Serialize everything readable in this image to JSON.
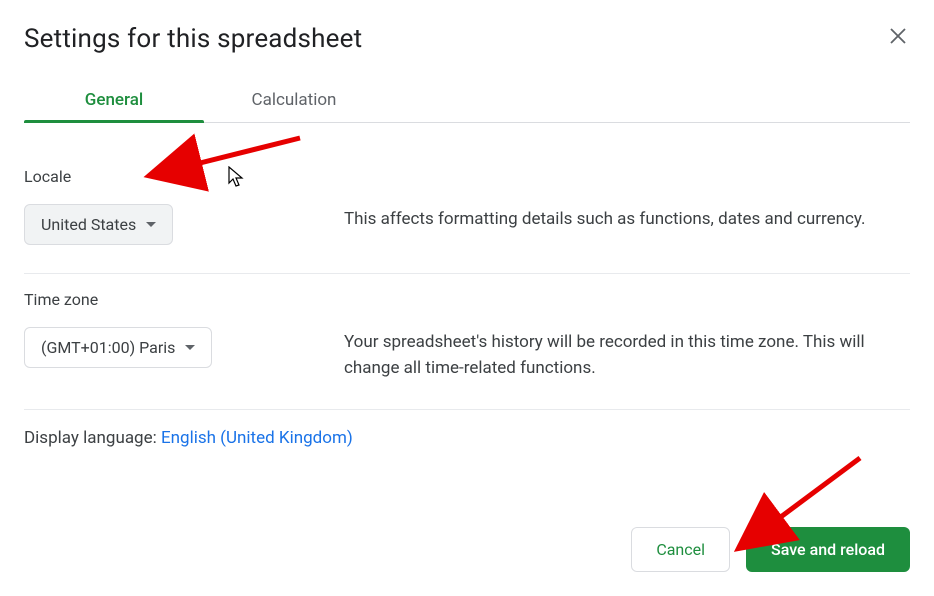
{
  "dialog": {
    "title": "Settings for this spreadsheet"
  },
  "tabs": {
    "general": "General",
    "calculation": "Calculation"
  },
  "locale": {
    "label": "Locale",
    "value": "United States",
    "description": "This affects formatting details such as functions, dates and currency."
  },
  "timezone": {
    "label": "Time zone",
    "value": "(GMT+01:00) Paris",
    "description": "Your spreadsheet's history will be recorded in this time zone. This will change all time-related functions."
  },
  "displayLanguage": {
    "label": "Display language: ",
    "value": "English (United Kingdom)"
  },
  "buttons": {
    "cancel": "Cancel",
    "save": "Save and reload"
  }
}
